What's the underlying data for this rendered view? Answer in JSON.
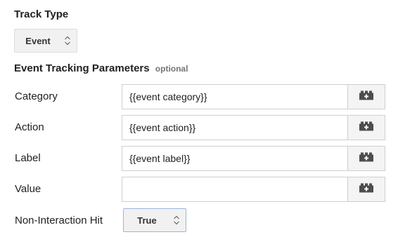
{
  "track_type": {
    "title": "Track Type",
    "selected": "Event"
  },
  "params": {
    "heading": "Event Tracking Parameters",
    "optional_tag": "optional",
    "rows": [
      {
        "label": "Category",
        "value": "{{event category}}"
      },
      {
        "label": "Action",
        "value": "{{event action}}"
      },
      {
        "label": "Label",
        "value": "{{event label}}"
      },
      {
        "label": "Value",
        "value": ""
      }
    ]
  },
  "non_interaction": {
    "label": "Non-Interaction Hit",
    "selected": "True"
  },
  "icons": {
    "select_arrows": "up-down-chevron-icon",
    "variable_picker": "lego-brick-plus-icon"
  }
}
